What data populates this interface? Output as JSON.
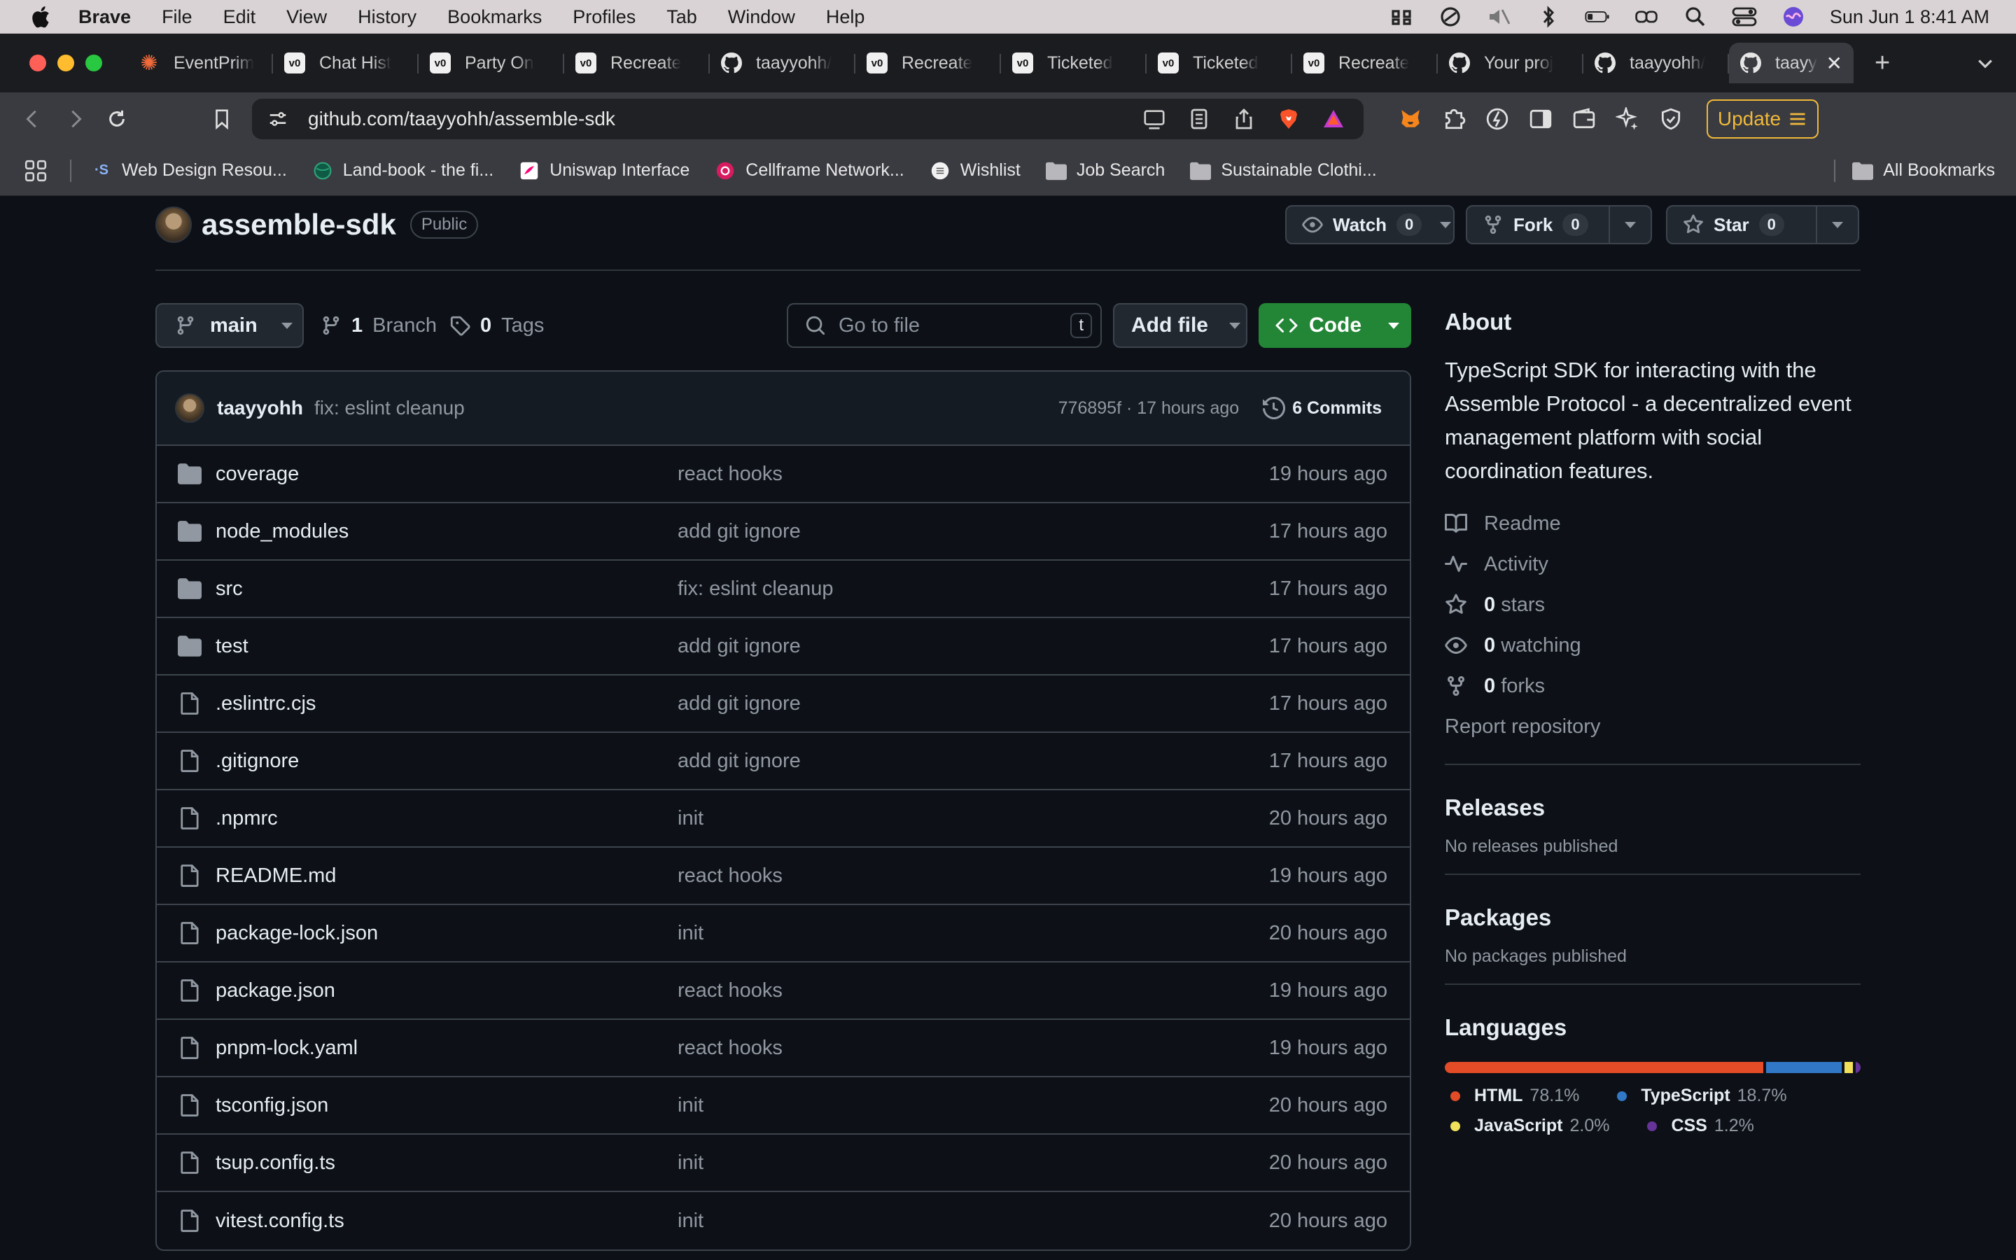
{
  "menubar": {
    "app": "Brave",
    "items": [
      "File",
      "Edit",
      "View",
      "History",
      "Bookmarks",
      "Profiles",
      "Tab",
      "Window",
      "Help"
    ],
    "clock": "Sun Jun 1  8:41 AM"
  },
  "tabs": [
    {
      "label": "EventPrim",
      "icon": "event-logo-icon"
    },
    {
      "label": "Chat Hist",
      "icon": "v0-icon"
    },
    {
      "label": "Party On",
      "icon": "v0-icon"
    },
    {
      "label": "Recreate",
      "icon": "v0-icon"
    },
    {
      "label": "taayyohh/",
      "icon": "github-icon"
    },
    {
      "label": "Recreate",
      "icon": "v0-icon"
    },
    {
      "label": "Ticketed",
      "icon": "v0-icon"
    },
    {
      "label": "Ticketed",
      "icon": "v0-icon"
    },
    {
      "label": "Recreate",
      "icon": "v0-icon"
    },
    {
      "label": "Your proj",
      "icon": "github-icon"
    },
    {
      "label": "taayyohh/",
      "icon": "github-icon"
    }
  ],
  "active_tab": {
    "label": "taayy",
    "icon": "github-icon"
  },
  "toolbar": {
    "url": "github.com/taayyohh/assemble-sdk",
    "update_label": "Update"
  },
  "bookmarks": [
    {
      "label": "Web Design Resou...",
      "icon": "s-icon"
    },
    {
      "label": "Land-book - the fi...",
      "icon": "globe-icon"
    },
    {
      "label": "Uniswap Interface",
      "icon": "uniswap-icon"
    },
    {
      "label": "Cellframe Network...",
      "icon": "cellframe-icon"
    },
    {
      "label": "Wishlist",
      "icon": "wishlist-icon"
    },
    {
      "label": "Job Search",
      "icon": "folder-icon"
    },
    {
      "label": "Sustainable Clothi...",
      "icon": "folder-icon"
    }
  ],
  "all_bookmarks": "All Bookmarks",
  "repo": {
    "name": "assemble-sdk",
    "visibility": "Public",
    "watch_label": "Watch",
    "watch_count": "0",
    "fork_label": "Fork",
    "fork_count": "0",
    "star_label": "Star",
    "star_count": "0"
  },
  "nav": {
    "branch": "main",
    "branch_count": "1",
    "branch_label": "Branch",
    "tag_count": "0",
    "tag_label": "Tags",
    "goto_placeholder": "Go to file",
    "goto_kbd": "t",
    "add_file": "Add file",
    "code": "Code"
  },
  "latest_commit": {
    "author": "taayyohh",
    "message": "fix: eslint cleanup",
    "meta": "776895f · 17 hours ago",
    "count": "6 Commits"
  },
  "files": [
    {
      "name": "coverage",
      "type": "dir",
      "message": "react hooks",
      "time": "19 hours ago"
    },
    {
      "name": "node_modules",
      "type": "dir",
      "message": "add git ignore",
      "time": "17 hours ago"
    },
    {
      "name": "src",
      "type": "dir",
      "message": "fix: eslint cleanup",
      "time": "17 hours ago"
    },
    {
      "name": "test",
      "type": "dir",
      "message": "add git ignore",
      "time": "17 hours ago"
    },
    {
      "name": ".eslintrc.cjs",
      "type": "file",
      "message": "add git ignore",
      "time": "17 hours ago"
    },
    {
      "name": ".gitignore",
      "type": "file",
      "message": "add git ignore",
      "time": "17 hours ago"
    },
    {
      "name": ".npmrc",
      "type": "file",
      "message": "init",
      "time": "20 hours ago"
    },
    {
      "name": "README.md",
      "type": "file",
      "message": "react hooks",
      "time": "19 hours ago"
    },
    {
      "name": "package-lock.json",
      "type": "file",
      "message": "init",
      "time": "20 hours ago"
    },
    {
      "name": "package.json",
      "type": "file",
      "message": "react hooks",
      "time": "19 hours ago"
    },
    {
      "name": "pnpm-lock.yaml",
      "type": "file",
      "message": "react hooks",
      "time": "19 hours ago"
    },
    {
      "name": "tsconfig.json",
      "type": "file",
      "message": "init",
      "time": "20 hours ago"
    },
    {
      "name": "tsup.config.ts",
      "type": "file",
      "message": "init",
      "time": "20 hours ago"
    },
    {
      "name": "vitest.config.ts",
      "type": "file",
      "message": "init",
      "time": "20 hours ago"
    }
  ],
  "about": {
    "title": "About",
    "description": "TypeScript SDK for interacting with the Assemble Protocol - a decentralized event management platform with social coordination features.",
    "readme": "Readme",
    "activity": "Activity",
    "stars_count": "0",
    "stars_label": "stars",
    "watching_count": "0",
    "watching_label": "watching",
    "forks_count": "0",
    "forks_label": "forks",
    "report": "Report repository"
  },
  "releases": {
    "title": "Releases",
    "empty": "No releases published"
  },
  "packages": {
    "title": "Packages",
    "empty": "No packages published"
  },
  "languages": {
    "title": "Languages",
    "items": [
      {
        "name": "HTML",
        "pct": "78.1%",
        "value": 78.1,
        "color": "#e34c26"
      },
      {
        "name": "TypeScript",
        "pct": "18.7%",
        "value": 18.7,
        "color": "#3178c6"
      },
      {
        "name": "JavaScript",
        "pct": "2.0%",
        "value": 2.0,
        "color": "#f1e05a"
      },
      {
        "name": "CSS",
        "pct": "1.2%",
        "value": 1.2,
        "color": "#663399"
      }
    ]
  }
}
